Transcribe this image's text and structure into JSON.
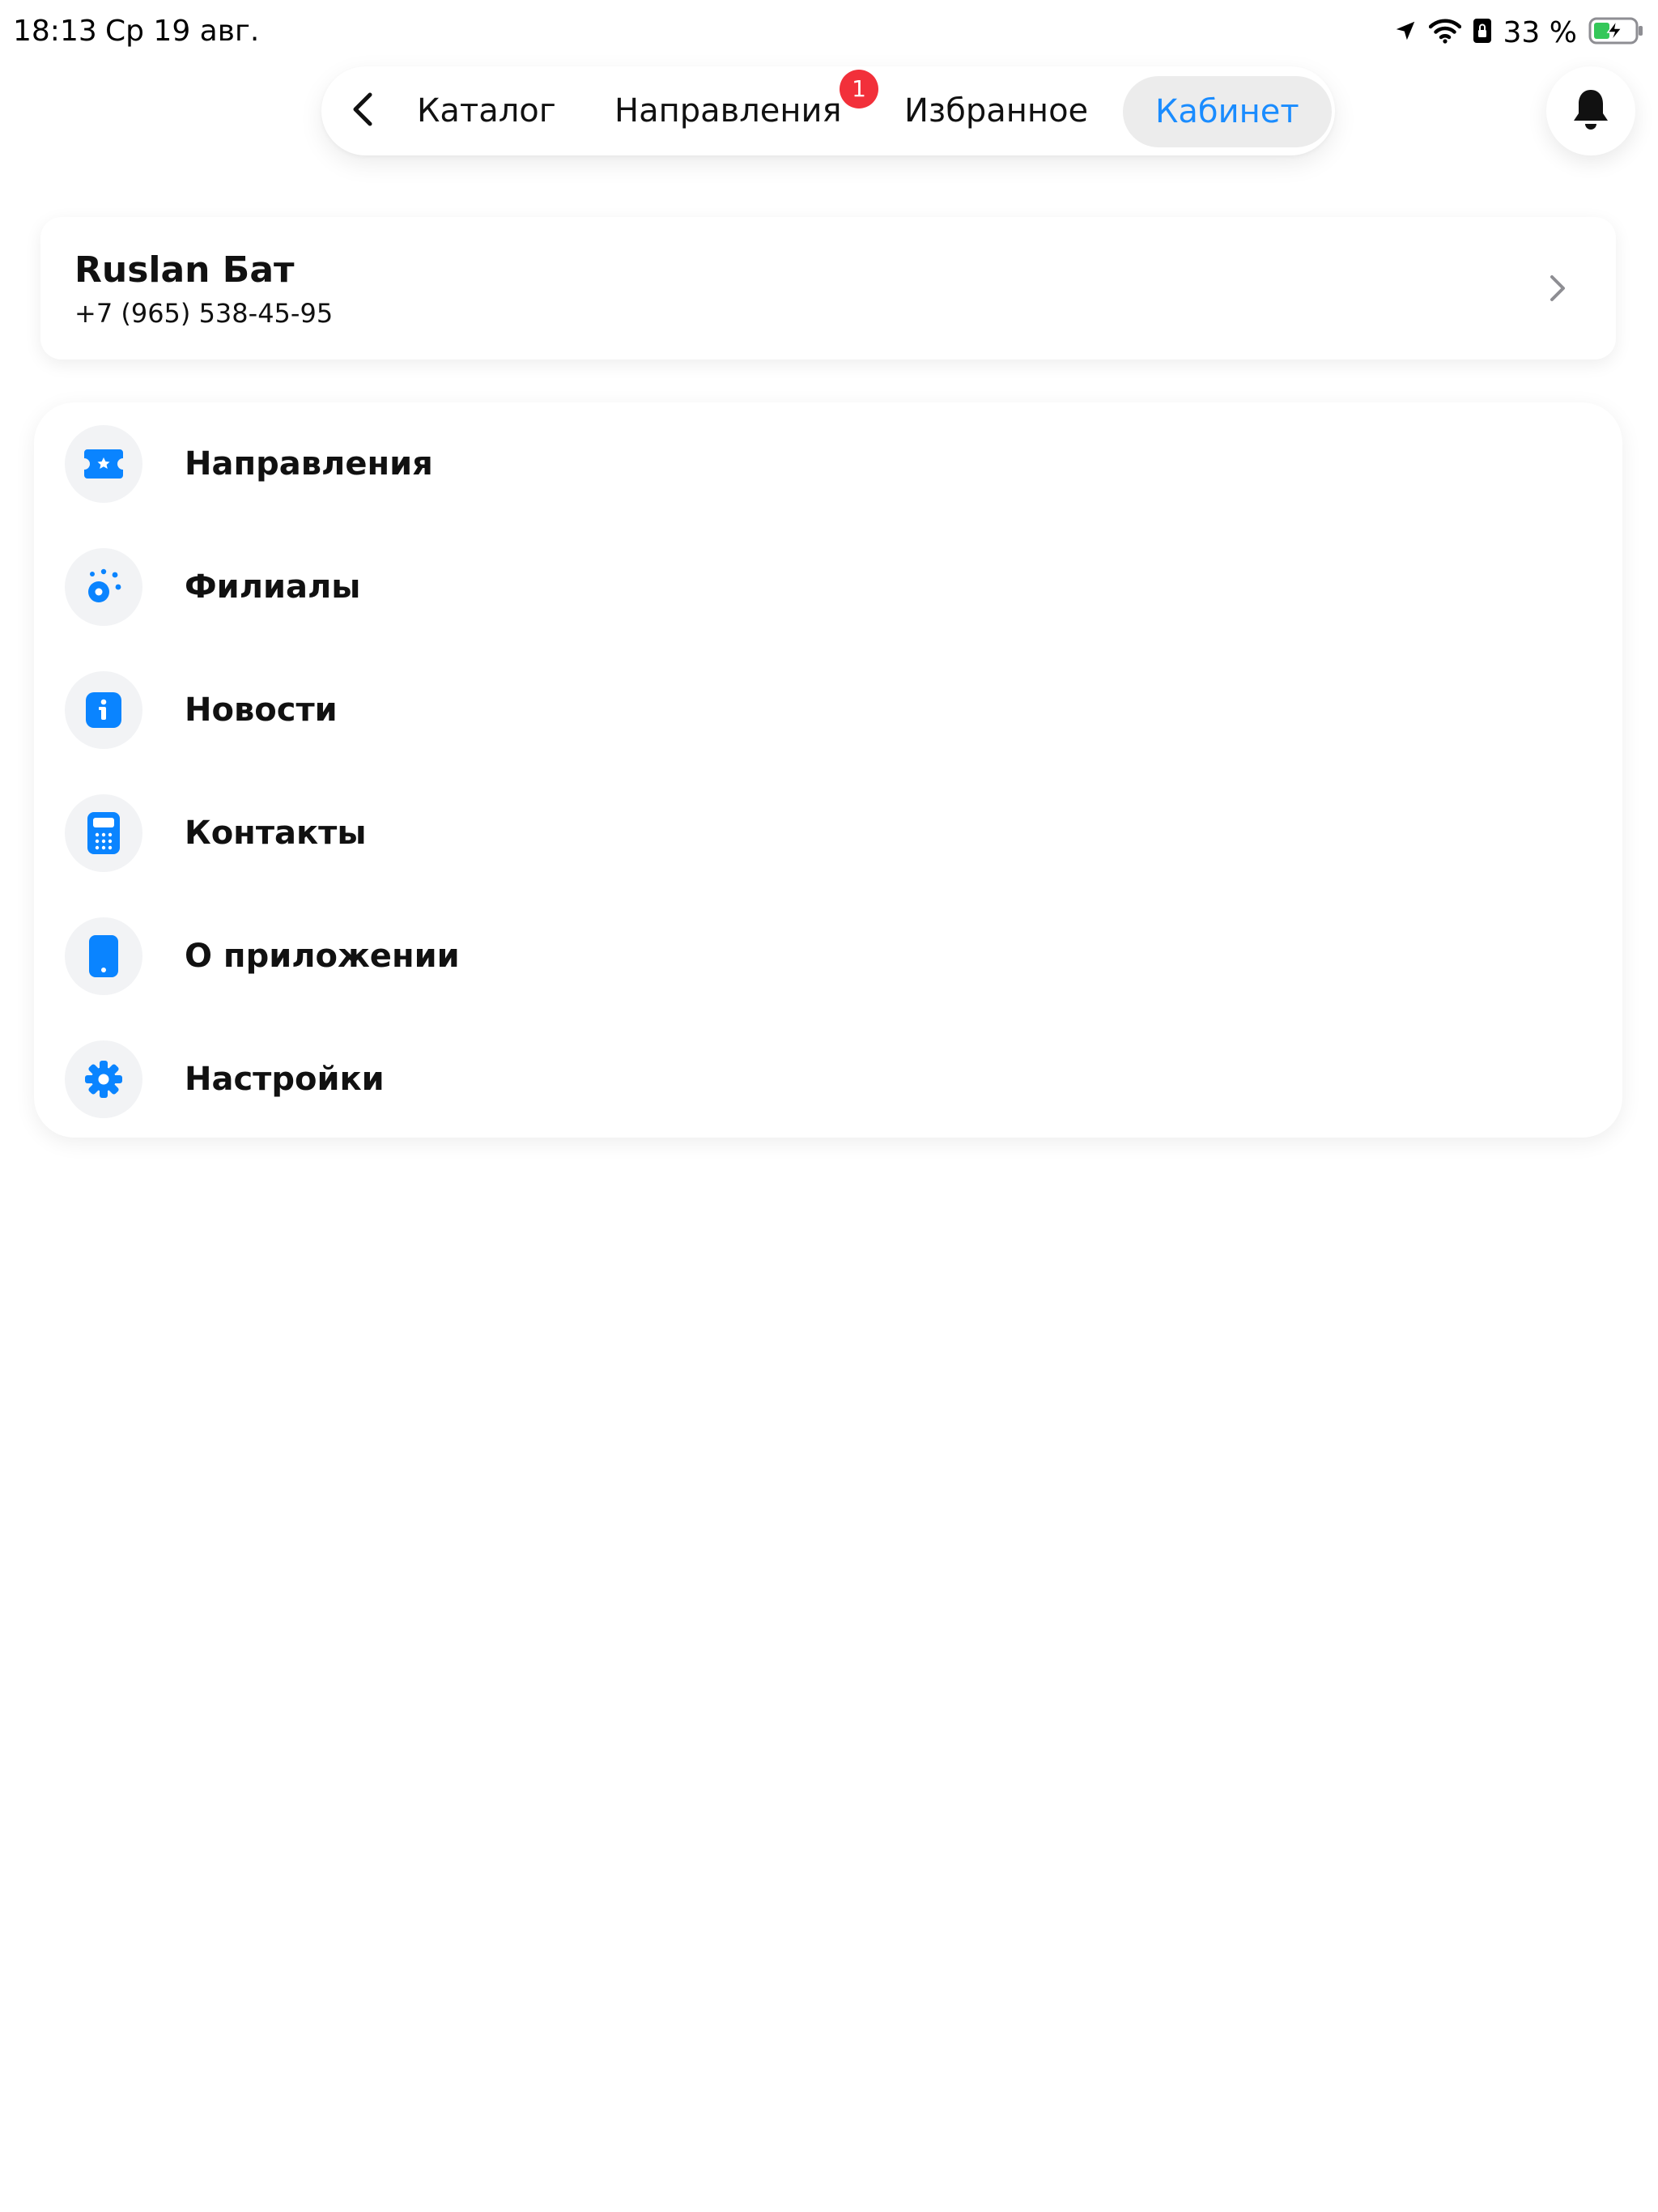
{
  "status_bar": {
    "time": "18:13",
    "date": "Ср 19 авг.",
    "battery_percent": "33 %",
    "icons": [
      "location-arrow-icon",
      "wifi-icon",
      "portrait-lock-icon",
      "battery-charging-icon"
    ]
  },
  "nav": {
    "back_icon": "chevron-left-icon",
    "tabs": [
      {
        "label": "Каталог",
        "active": false
      },
      {
        "label": "Направления",
        "active": false,
        "badge": "1"
      },
      {
        "label": "Избранное",
        "active": false
      },
      {
        "label": "Кабинет",
        "active": true
      }
    ],
    "notifications_icon": "bell-icon"
  },
  "profile": {
    "name": "Ruslan Бат",
    "phone": "+7 (965) 538-45-95",
    "chevron_icon": "chevron-right-icon"
  },
  "menu": {
    "items": [
      {
        "label": "Направления",
        "icon": "ticket-icon"
      },
      {
        "label": "Филиалы",
        "icon": "branches-icon"
      },
      {
        "label": "Новости",
        "icon": "info-icon"
      },
      {
        "label": "Контакты",
        "icon": "phone-keypad-icon"
      },
      {
        "label": "О приложении",
        "icon": "smartphone-icon"
      },
      {
        "label": "Настройки",
        "icon": "gear-icon"
      }
    ]
  },
  "colors": {
    "accent": "#1a8cff",
    "icon_blue": "#0a84ff",
    "badge_red": "#f2303a",
    "icon_bg": "#f2f3f5",
    "active_tab_bg": "#ececec",
    "battery_green": "#34c759"
  }
}
